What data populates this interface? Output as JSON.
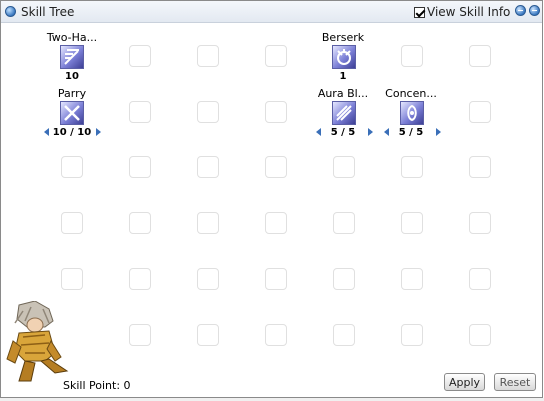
{
  "window": {
    "title": "Skill Tree",
    "view_skill_info_label": "View Skill Info",
    "view_skill_info_checked": true
  },
  "skills": [
    {
      "name": "Two-Ha...",
      "level": "10",
      "has_arrows": false
    },
    {
      "name": "Berserk",
      "level": "1",
      "has_arrows": false
    },
    {
      "name": "Parry",
      "level": "10 / 10",
      "has_arrows": true
    },
    {
      "name": "Aura Bl...",
      "level": "5 / 5",
      "has_arrows": true
    },
    {
      "name": "Concen...",
      "level": "5 / 5",
      "has_arrows": true
    }
  ],
  "footer": {
    "skill_point_label": "Skill Point: 0",
    "apply_label": "Apply",
    "reset_label": "Reset"
  },
  "colors": {
    "accent": "#3a78c0",
    "icon_background": "#7b7fd6"
  }
}
